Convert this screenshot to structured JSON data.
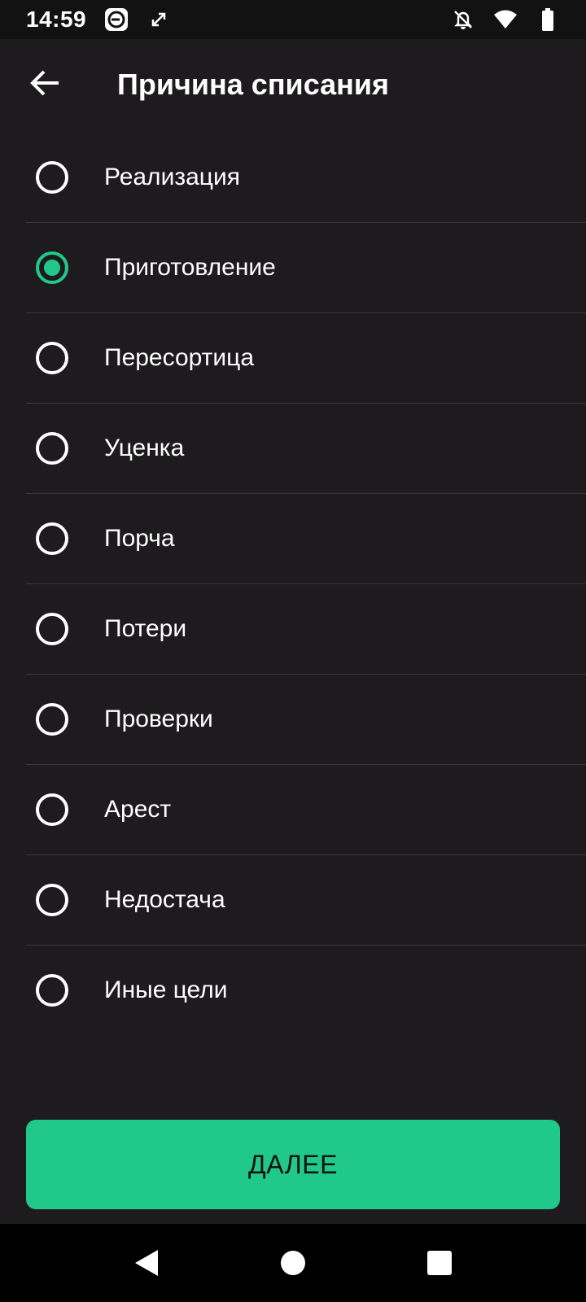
{
  "status_bar": {
    "time": "14:59",
    "icons": [
      "app-e-icon",
      "sync-arrows-icon",
      "bell-off-icon",
      "wifi-icon",
      "battery-icon"
    ]
  },
  "header": {
    "title": "Причина списания",
    "back_icon": "arrow-left-icon"
  },
  "reasons": [
    {
      "label": "Реализация",
      "selected": false
    },
    {
      "label": "Приготовление",
      "selected": true
    },
    {
      "label": "Пересортица",
      "selected": false
    },
    {
      "label": "Уценка",
      "selected": false
    },
    {
      "label": "Порча",
      "selected": false
    },
    {
      "label": "Потери",
      "selected": false
    },
    {
      "label": "Проверки",
      "selected": false
    },
    {
      "label": "Арест",
      "selected": false
    },
    {
      "label": "Недостача",
      "selected": false
    },
    {
      "label": "Иные цели",
      "selected": false
    }
  ],
  "next_button": {
    "label": "ДАЛЕЕ"
  },
  "colors": {
    "accent": "#20c98a",
    "background": "#1d1b1d"
  }
}
